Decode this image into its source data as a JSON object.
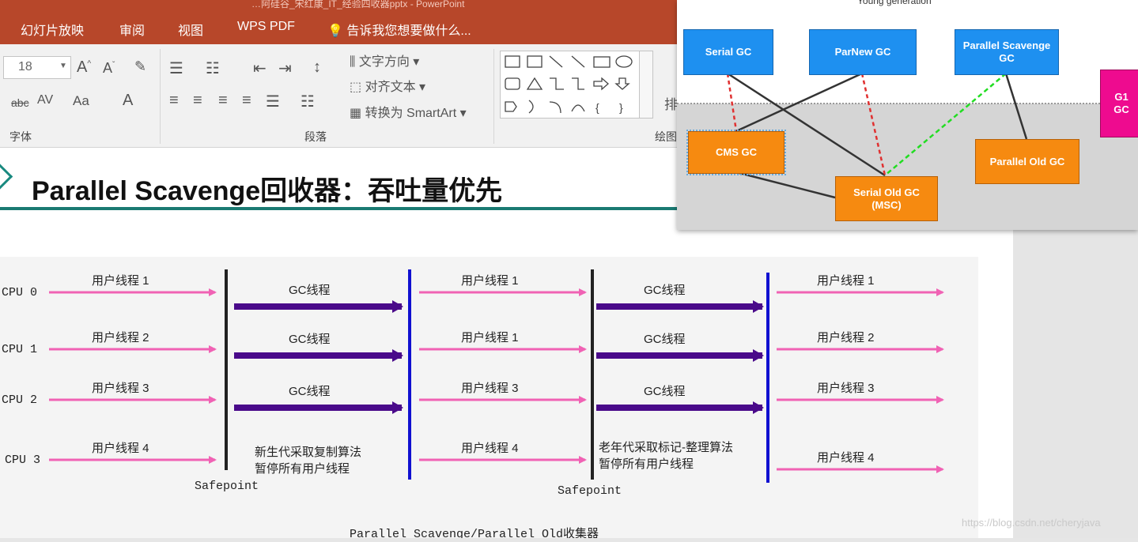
{
  "window": {
    "title": "…阿硅谷_宋红康_IT_经验四收器pptx - PowerPoint"
  },
  "menu": [
    "幻灯片放映",
    "审阅",
    "视图",
    "WPS PDF"
  ],
  "tell_me": "告诉我您想要做什么...",
  "ribbon": {
    "font_size": "18",
    "group_font": "字体",
    "group_paragraph": "段落",
    "group_draw": "绘图",
    "text_direction": "文字方向",
    "align_text": "对齐文本",
    "convert_smartart": "转换为 SmartArt",
    "arrange": "排",
    "btn_abc": "abc",
    "btn_av": "AV",
    "btn_aa": "Aa",
    "btn_a": "A"
  },
  "slide": {
    "title": "Parallel Scavenge回收器：吞吐量优先",
    "cpus": [
      "CPU 0",
      "CPU 1",
      "CPU 2",
      "CPU 3"
    ],
    "phase1": [
      "用户线程 1",
      "用户线程 2",
      "用户线程 3",
      "用户线程 4"
    ],
    "phase2": [
      "GC线程",
      "GC线程",
      "GC线程"
    ],
    "phase2_note": [
      "新生代采取复制算法",
      "暂停所有用户线程"
    ],
    "phase3": [
      "用户线程 1",
      "用户线程 1",
      "用户线程 3",
      "用户线程 4"
    ],
    "phase4": [
      "GC线程",
      "GC线程",
      "GC线程"
    ],
    "phase4_note": [
      "老年代采取标记-整理算法",
      "暂停所有用户线程"
    ],
    "phase5": [
      "用户线程 1",
      "用户线程 2",
      "用户线程 3",
      "用户线程 4"
    ],
    "safepoint_label": "Safepoint",
    "caption": "Parallel Scavenge/Parallel Old收集器",
    "colors": {
      "user_arrow": "#f062b4",
      "gc_arrow": "#4a0a8a",
      "black_bar": "#222222",
      "blue_bar": "#1010d0"
    }
  },
  "overlay": {
    "title": "Young generation",
    "serial": "Serial GC",
    "parnew": "ParNew GC",
    "parallel_scavenge": [
      "Parallel Scavenge",
      "GC"
    ],
    "cms": "CMS GC",
    "serial_old": [
      "Serial Old GC",
      "(MSC)"
    ],
    "parallel_old": "Parallel Old GC",
    "g1": [
      "G1",
      "GC"
    ]
  },
  "watermark": "https://blog.csdn.net/cheryjava"
}
